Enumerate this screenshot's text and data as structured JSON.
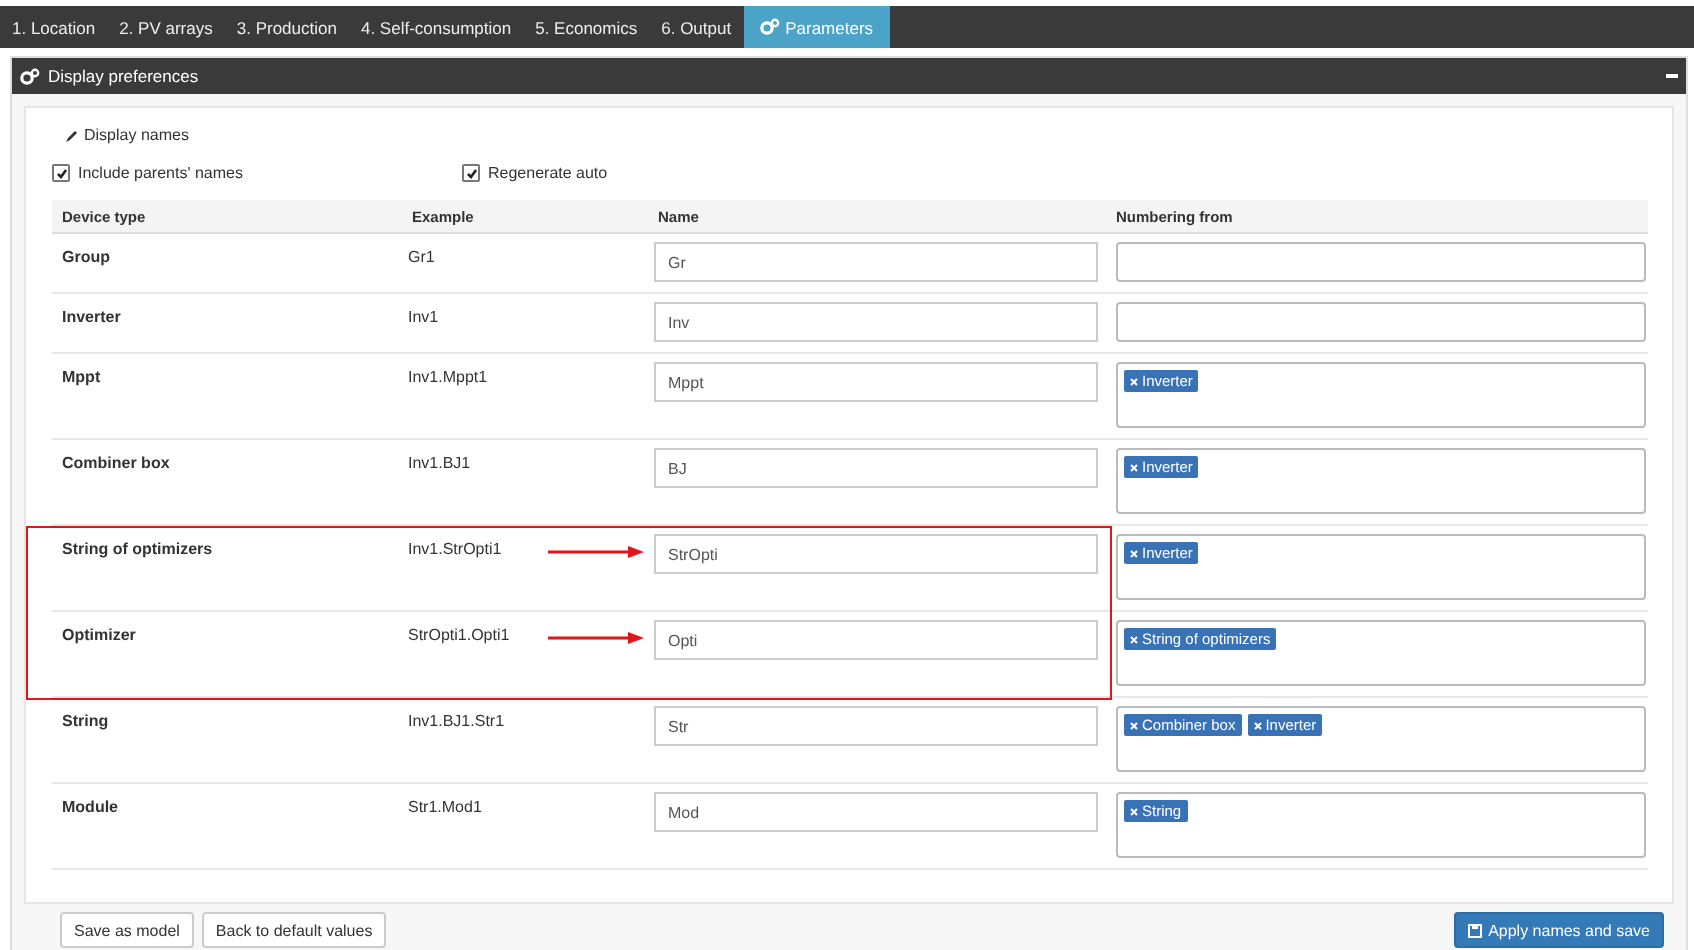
{
  "tabs": [
    {
      "label": "1. Location",
      "selected": false
    },
    {
      "label": "2. PV arrays",
      "selected": false
    },
    {
      "label": "3. Production",
      "selected": false
    },
    {
      "label": "4. Self-consumption",
      "selected": false
    },
    {
      "label": "5. Economics",
      "selected": false
    },
    {
      "label": "6. Output",
      "selected": false
    },
    {
      "label": "Parameters",
      "selected": true
    }
  ],
  "panel": {
    "title": "Display preferences",
    "section_title": "Display names",
    "options": [
      {
        "label": "Include parents' names",
        "checked": true
      },
      {
        "label": "Regenerate auto",
        "checked": true
      }
    ],
    "table": {
      "columns": [
        "Device type",
        "Example",
        "Name",
        "Numbering from"
      ],
      "rows": [
        {
          "device_type": "Group",
          "example": "Gr1",
          "name": "Gr",
          "numbering_from": [],
          "annotated": false
        },
        {
          "device_type": "Inverter",
          "example": "Inv1",
          "name": "Inv",
          "numbering_from": [],
          "annotated": false
        },
        {
          "device_type": "Mppt",
          "example": "Inv1.Mppt1",
          "name": "Mppt",
          "numbering_from": [
            "Inverter"
          ],
          "annotated": false
        },
        {
          "device_type": "Combiner box",
          "example": "Inv1.BJ1",
          "name": "BJ",
          "numbering_from": [
            "Inverter"
          ],
          "annotated": false
        },
        {
          "device_type": "String of optimizers",
          "example": "Inv1.StrOpti1",
          "name": "StrOpti",
          "numbering_from": [
            "Inverter"
          ],
          "annotated": true
        },
        {
          "device_type": "Optimizer",
          "example": "StrOpti1.Opti1",
          "name": "Opti",
          "numbering_from": [
            "String of optimizers"
          ],
          "annotated": true
        },
        {
          "device_type": "String",
          "example": "Inv1.BJ1.Str1",
          "name": "Str",
          "numbering_from": [
            "Combiner box",
            "Inverter"
          ],
          "annotated": false
        },
        {
          "device_type": "Module",
          "example": "Str1.Mod1",
          "name": "Mod",
          "numbering_from": [
            "String"
          ],
          "annotated": false
        }
      ]
    },
    "buttons": [
      "Save as model",
      "Back to default values"
    ],
    "primary_button": "Apply names and save"
  }
}
